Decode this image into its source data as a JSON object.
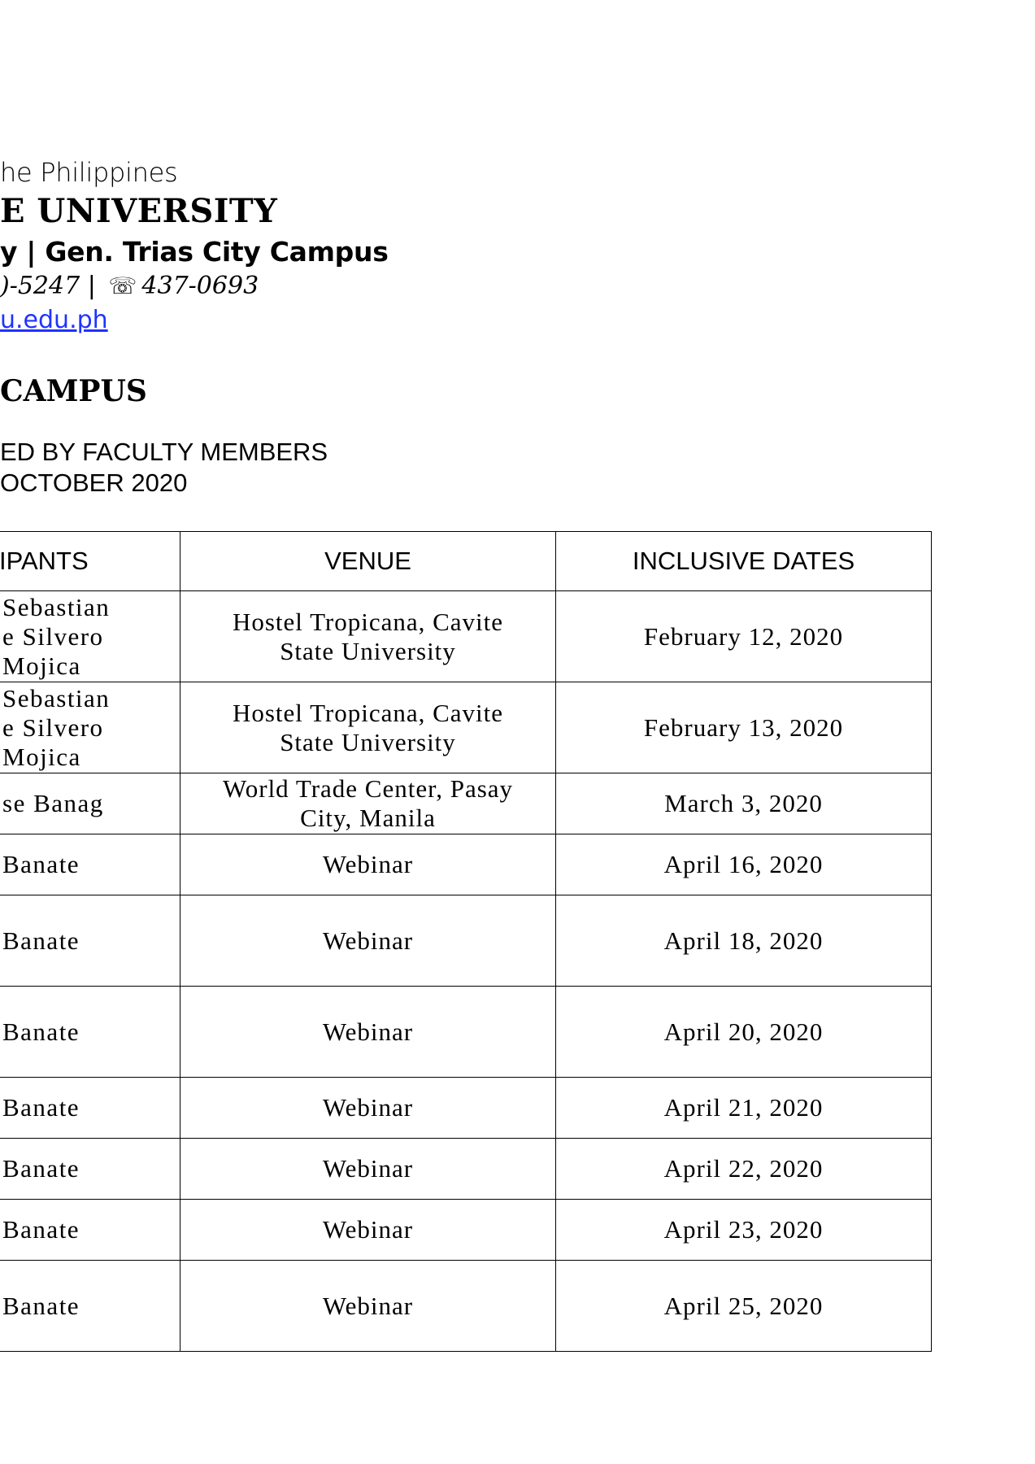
{
  "header": {
    "country": "he Philippines",
    "university": "E UNIVERSITY",
    "campus_line": "y | Gen. Trias City Campus",
    "contact_left": ")-5247",
    "contact_sep": " | ",
    "phone_icon": "☏",
    "contact_right": "437-0693",
    "website": "u.edu.ph"
  },
  "title": {
    "campus": "CAMPUS",
    "subtitle1": "ED BY FACULTY MEMBERS",
    "subtitle2": "OCTOBER 2020"
  },
  "table": {
    "headers": [
      "IPANTS",
      "VENUE",
      "INCLUSIVE DATES"
    ],
    "rows": [
      {
        "participants": [
          "Sebastian",
          "e Silvero",
          " Mojica"
        ],
        "venue": [
          "Hostel Tropicana, Cavite",
          "State University"
        ],
        "date": "February 12, 2020"
      },
      {
        "participants": [
          "Sebastian",
          "e Silvero",
          " Mojica"
        ],
        "venue": [
          "Hostel Tropicana, Cavite",
          "State University"
        ],
        "date": "February 13, 2020"
      },
      {
        "participants": [
          "se Banag"
        ],
        "venue": [
          "World Trade Center, Pasay",
          "City, Manila"
        ],
        "date": "March 3, 2020"
      },
      {
        "participants": [
          " Banate"
        ],
        "venue": [
          "Webinar"
        ],
        "date": "April 16, 2020"
      },
      {
        "participants": [
          " Banate"
        ],
        "venue": [
          "Webinar"
        ],
        "date": "April 18, 2020"
      },
      {
        "participants": [
          " Banate"
        ],
        "venue": [
          "Webinar"
        ],
        "date": "April 20, 2020"
      },
      {
        "participants": [
          " Banate"
        ],
        "venue": [
          "Webinar"
        ],
        "date": "April 21, 2020"
      },
      {
        "participants": [
          " Banate"
        ],
        "venue": [
          "Webinar"
        ],
        "date": "April 22, 2020"
      },
      {
        "participants": [
          " Banate"
        ],
        "venue": [
          "Webinar"
        ],
        "date": "April 23, 2020"
      },
      {
        "participants": [
          " Banate"
        ],
        "venue": [
          "Webinar"
        ],
        "date": "April 25, 2020"
      }
    ]
  }
}
